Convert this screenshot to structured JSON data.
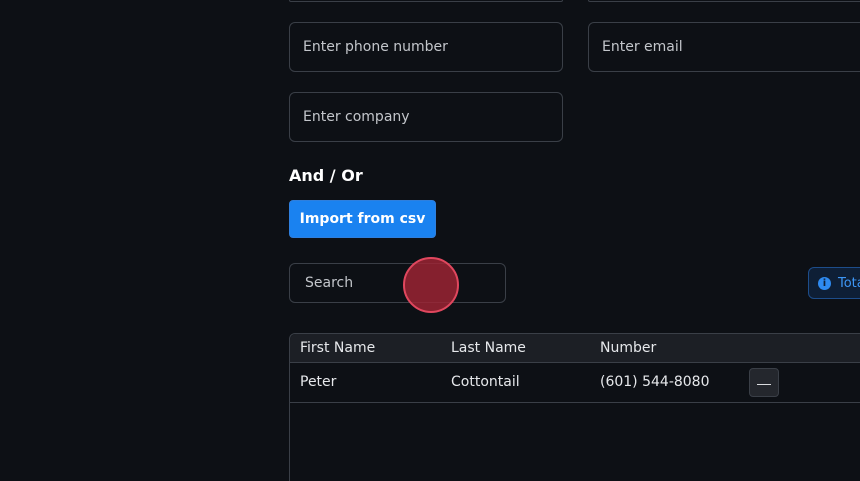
{
  "form": {
    "phone_placeholder": "Enter phone number",
    "email_placeholder": "Enter email",
    "company_placeholder": "Enter company"
  },
  "section": {
    "heading": "And / Or",
    "import_label": "Import from csv"
  },
  "search": {
    "placeholder": "Search"
  },
  "total": {
    "label": "Tota",
    "icon": "info-icon"
  },
  "table": {
    "headers": [
      "First Name",
      "Last Name",
      "Number"
    ],
    "rows": [
      {
        "first_name": "Peter",
        "last_name": "Cottontail",
        "number": "(601) 544-8080",
        "remove_label": "—"
      }
    ]
  },
  "colors": {
    "background": "#0d1015",
    "accent": "#1a82f0",
    "border": "#3a3f47",
    "cursor": "#a02434"
  }
}
